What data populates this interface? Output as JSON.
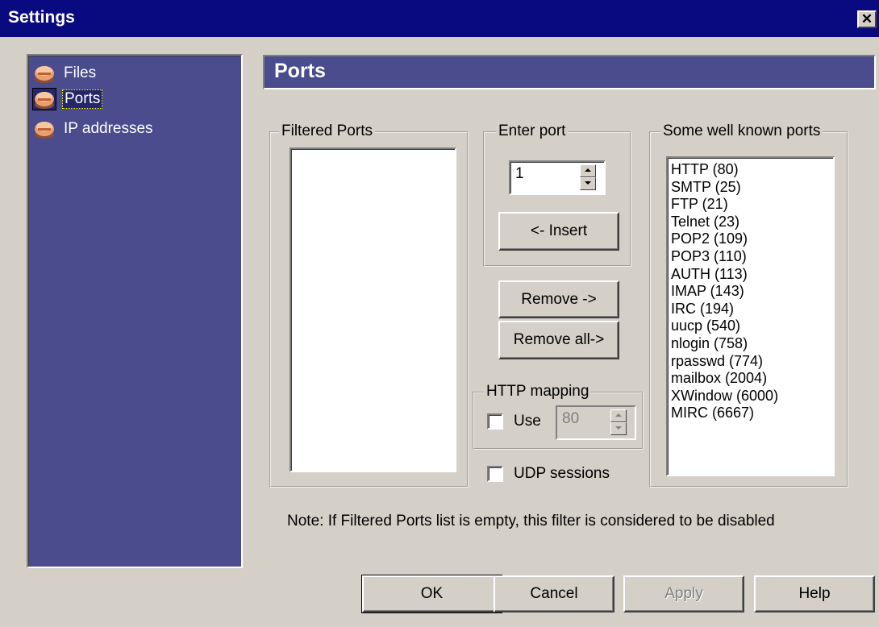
{
  "window": {
    "title": "Settings",
    "close_label": "✕"
  },
  "sidebar": {
    "items": [
      {
        "label": "Files",
        "icon": "package-icon",
        "selected": false
      },
      {
        "label": "Ports",
        "icon": "package-icon",
        "selected": true
      },
      {
        "label": "IP addresses",
        "icon": "package-icon",
        "selected": false
      }
    ]
  },
  "header": {
    "title": "Ports"
  },
  "filtered_ports": {
    "label": "Filtered Ports",
    "items": []
  },
  "enter_port": {
    "label": "Enter port",
    "value": "1",
    "insert_label": "<- Insert"
  },
  "remove_label": "Remove ->",
  "remove_all_label": "Remove all->",
  "http_mapping": {
    "label": "HTTP mapping",
    "use_label": "Use",
    "use_checked": false,
    "port_value": "80"
  },
  "udp_sessions": {
    "label": "UDP sessions",
    "checked": false
  },
  "well_known": {
    "label": "Some well known ports",
    "items": [
      "HTTP (80)",
      "SMTP (25)",
      "FTP (21)",
      "Telnet (23)",
      "POP2 (109)",
      "POP3 (110)",
      "AUTH (113)",
      "IMAP (143)",
      "IRC (194)",
      "uucp (540)",
      "nlogin (758)",
      "rpasswd (774)",
      "mailbox (2004)",
      "XWindow (6000)",
      "MIRC (6667)"
    ]
  },
  "note": "Note: If Filtered Ports list is empty, this filter is considered to be disabled",
  "footer": {
    "ok": "OK",
    "cancel": "Cancel",
    "apply": "Apply",
    "help": "Help"
  },
  "colors": {
    "titlebar": "#0a0a80",
    "panel": "#4a4c8e",
    "face": "#d4d0c8"
  }
}
